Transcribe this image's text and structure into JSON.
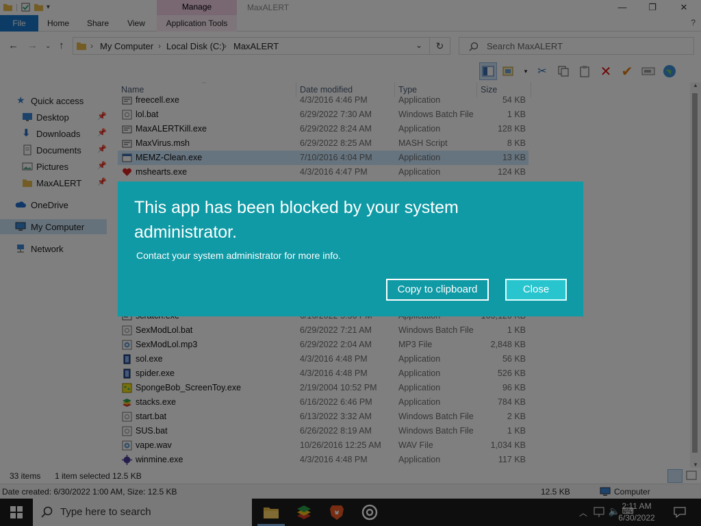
{
  "window": {
    "title": "MaxALERT",
    "context_tab": "Manage",
    "minimize": "—",
    "maximize": "❐",
    "close": "✕"
  },
  "ribbon": {
    "tabs": [
      "File",
      "Home",
      "Share",
      "View",
      "Application Tools"
    ],
    "help": "?"
  },
  "address": {
    "crumbs": [
      "My Computer",
      "Local Disk (C:)",
      "MaxALERT"
    ],
    "search_placeholder": "Search MaxALERT"
  },
  "columns": [
    "Name",
    "Date modified",
    "Type",
    "Size"
  ],
  "nav": [
    {
      "label": "Quick access",
      "icon": "star-icon",
      "pinned": false
    },
    {
      "label": "Desktop",
      "icon": "desktop-icon",
      "pinned": true
    },
    {
      "label": "Downloads",
      "icon": "download-icon",
      "pinned": true
    },
    {
      "label": "Documents",
      "icon": "documents-icon",
      "pinned": true
    },
    {
      "label": "Pictures",
      "icon": "pictures-icon",
      "pinned": true
    },
    {
      "label": "MaxALERT",
      "icon": "folder-icon",
      "pinned": true
    },
    {
      "label": "OneDrive",
      "icon": "cloud-icon",
      "pinned": false
    },
    {
      "label": "My Computer",
      "icon": "computer-icon",
      "pinned": false
    },
    {
      "label": "Network",
      "icon": "network-icon",
      "pinned": false
    }
  ],
  "files_top": [
    {
      "name": "freecell.exe",
      "date": "4/3/2016 4:46 PM",
      "type": "Application",
      "size": "54 KB",
      "icon": "app"
    },
    {
      "name": "lol.bat",
      "date": "6/29/2022 7:30 AM",
      "type": "Windows Batch File",
      "size": "1 KB",
      "icon": "bat"
    },
    {
      "name": "MaxALERTKill.exe",
      "date": "6/29/2022 8:24 AM",
      "type": "Application",
      "size": "128 KB",
      "icon": "app"
    },
    {
      "name": "MaxVirus.msh",
      "date": "6/29/2022 8:25 AM",
      "type": "MASH Script",
      "size": "8 KB",
      "icon": "app"
    },
    {
      "name": "MEMZ-Clean.exe",
      "date": "7/10/2016 4:04 PM",
      "type": "Application",
      "size": "13 KB",
      "icon": "window"
    },
    {
      "name": "mshearts.exe",
      "date": "4/3/2016 4:47 PM",
      "type": "Application",
      "size": "124 KB",
      "icon": "heart"
    }
  ],
  "files_bottom": [
    {
      "name": "scratch.exe",
      "date": "6/16/2022 5:36 PM",
      "type": "Application",
      "size": "103,120 KB",
      "icon": "app"
    },
    {
      "name": "SexModLol.bat",
      "date": "6/29/2022 7:21 AM",
      "type": "Windows Batch File",
      "size": "1 KB",
      "icon": "bat"
    },
    {
      "name": "SexModLol.mp3",
      "date": "6/29/2022 2:04 AM",
      "type": "MP3 File",
      "size": "2,848 KB",
      "icon": "media"
    },
    {
      "name": "sol.exe",
      "date": "4/3/2016 4:48 PM",
      "type": "Application",
      "size": "56 KB",
      "icon": "cards"
    },
    {
      "name": "spider.exe",
      "date": "4/3/2016 4:48 PM",
      "type": "Application",
      "size": "526 KB",
      "icon": "cards"
    },
    {
      "name": "SpongeBob_ScreenToy.exe",
      "date": "2/19/2004 10:52 PM",
      "type": "Application",
      "size": "96 KB",
      "icon": "sponge"
    },
    {
      "name": "stacks.exe",
      "date": "6/16/2022 6:46 PM",
      "type": "Application",
      "size": "784 KB",
      "icon": "stack"
    },
    {
      "name": "start.bat",
      "date": "6/13/2022 3:32 AM",
      "type": "Windows Batch File",
      "size": "2 KB",
      "icon": "bat"
    },
    {
      "name": "SUS.bat",
      "date": "6/26/2022 8:19 AM",
      "type": "Windows Batch File",
      "size": "1 KB",
      "icon": "bat"
    },
    {
      "name": "vape.wav",
      "date": "10/26/2016 12:25 AM",
      "type": "WAV File",
      "size": "1,034 KB",
      "icon": "media"
    },
    {
      "name": "winmine.exe",
      "date": "4/3/2016 4:48 PM",
      "type": "Application",
      "size": "117 KB",
      "icon": "mine"
    }
  ],
  "status": {
    "items": "33 items",
    "selected": "1 item selected  12.5 KB"
  },
  "details": {
    "text": "Date created: 6/30/2022 1:00 AM, Size: 12.5 KB",
    "size": "12.5 KB",
    "location": "Computer"
  },
  "taskbar": {
    "search_placeholder": "Type here to search",
    "time": "2:11 AM",
    "date": "6/30/2022"
  },
  "dialog": {
    "title": "This app has been blocked by your system administrator.",
    "message": "Contact your system administrator for more info.",
    "copy_label": "Copy to clipboard",
    "close_label": "Close"
  },
  "colors": {
    "dialog_bg": "#0f9aa5",
    "close_btn_bg": "#28c5cf",
    "selection": "#cce8ff",
    "taskbar": "#1c1c1c"
  }
}
